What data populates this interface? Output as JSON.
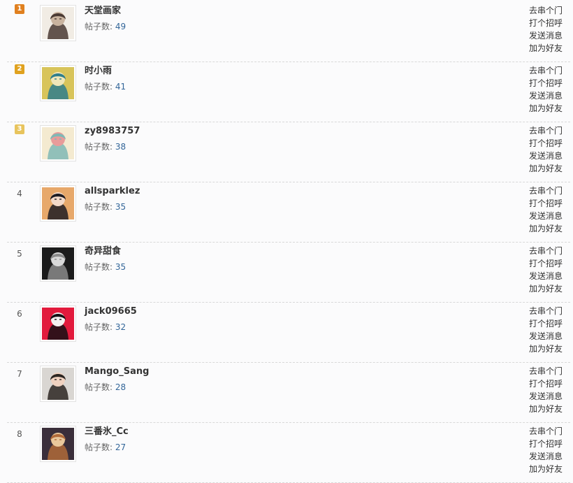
{
  "rows": [
    {
      "rank": "1",
      "medal": "gold",
      "username": "天堂画家",
      "post_label": "帖子数:",
      "post_count": "49",
      "avatar": {
        "desc": "anime-girl-dark-hair",
        "bg": "#f1ece4",
        "fg": "#4a3a33",
        "accent": "#c9b39e"
      },
      "actions": [
        "去串个门",
        "打个招呼",
        "发送消息",
        "加为好友"
      ]
    },
    {
      "rank": "2",
      "medal": "silver",
      "username": "时小雨",
      "post_label": "帖子数:",
      "post_count": "41",
      "avatar": {
        "desc": "anime-girl-blonde-teal",
        "bg": "#d8c45a",
        "fg": "#2f7e8c",
        "accent": "#f0e6b8"
      },
      "actions": [
        "去串个门",
        "打个招呼",
        "发送消息",
        "加为好友"
      ]
    },
    {
      "rank": "3",
      "medal": "bronze",
      "username": "zy8983757",
      "post_label": "帖子数:",
      "post_count": "38",
      "avatar": {
        "desc": "anime-girl-blushing",
        "bg": "#f4ead0",
        "fg": "#7fb8b5",
        "accent": "#e89c9a"
      },
      "actions": [
        "去串个门",
        "打个招呼",
        "发送消息",
        "加为好友"
      ]
    },
    {
      "rank": "4",
      "medal": "",
      "username": "allsparklez",
      "post_label": "帖子数:",
      "post_count": "35",
      "avatar": {
        "desc": "anime-girl-black-hair",
        "bg": "#e7a86a",
        "fg": "#1e1c22",
        "accent": "#f3d9c8"
      },
      "actions": [
        "去串个门",
        "打个招呼",
        "发送消息",
        "加为好友"
      ]
    },
    {
      "rank": "5",
      "medal": "",
      "username": "奇异甜食",
      "post_label": "帖子数:",
      "post_count": "35",
      "avatar": {
        "desc": "dark-abstract-figure",
        "bg": "#1b1b1b",
        "fg": "#8a8a8a",
        "accent": "#d9d9d9"
      },
      "actions": [
        "去串个门",
        "打个招呼",
        "发送消息",
        "加为好友"
      ]
    },
    {
      "rank": "6",
      "medal": "",
      "username": "jack09665",
      "post_label": "帖子数:",
      "post_count": "32",
      "avatar": {
        "desc": "red-poster-figure",
        "bg": "#e21a3c",
        "fg": "#141014",
        "accent": "#f4f0f0"
      },
      "actions": [
        "去串个门",
        "打个招呼",
        "发送消息",
        "加为好友"
      ]
    },
    {
      "rank": "7",
      "medal": "",
      "username": "Mango_Sang",
      "post_label": "帖子数:",
      "post_count": "28",
      "avatar": {
        "desc": "photo-couple",
        "bg": "#d9d6d2",
        "fg": "#2b2622",
        "accent": "#f0d2c0"
      },
      "actions": [
        "去串个门",
        "打个招呼",
        "发送消息",
        "加为好友"
      ]
    },
    {
      "rank": "8",
      "medal": "",
      "username": "三番氷_Cc",
      "post_label": "帖子数:",
      "post_count": "27",
      "avatar": {
        "desc": "anime-girl-brown-hair",
        "bg": "#3a2e3a",
        "fg": "#b06a3a",
        "accent": "#e9c89c"
      },
      "actions": [
        "去串个门",
        "打个招呼",
        "发送消息",
        "加为好友"
      ]
    }
  ]
}
